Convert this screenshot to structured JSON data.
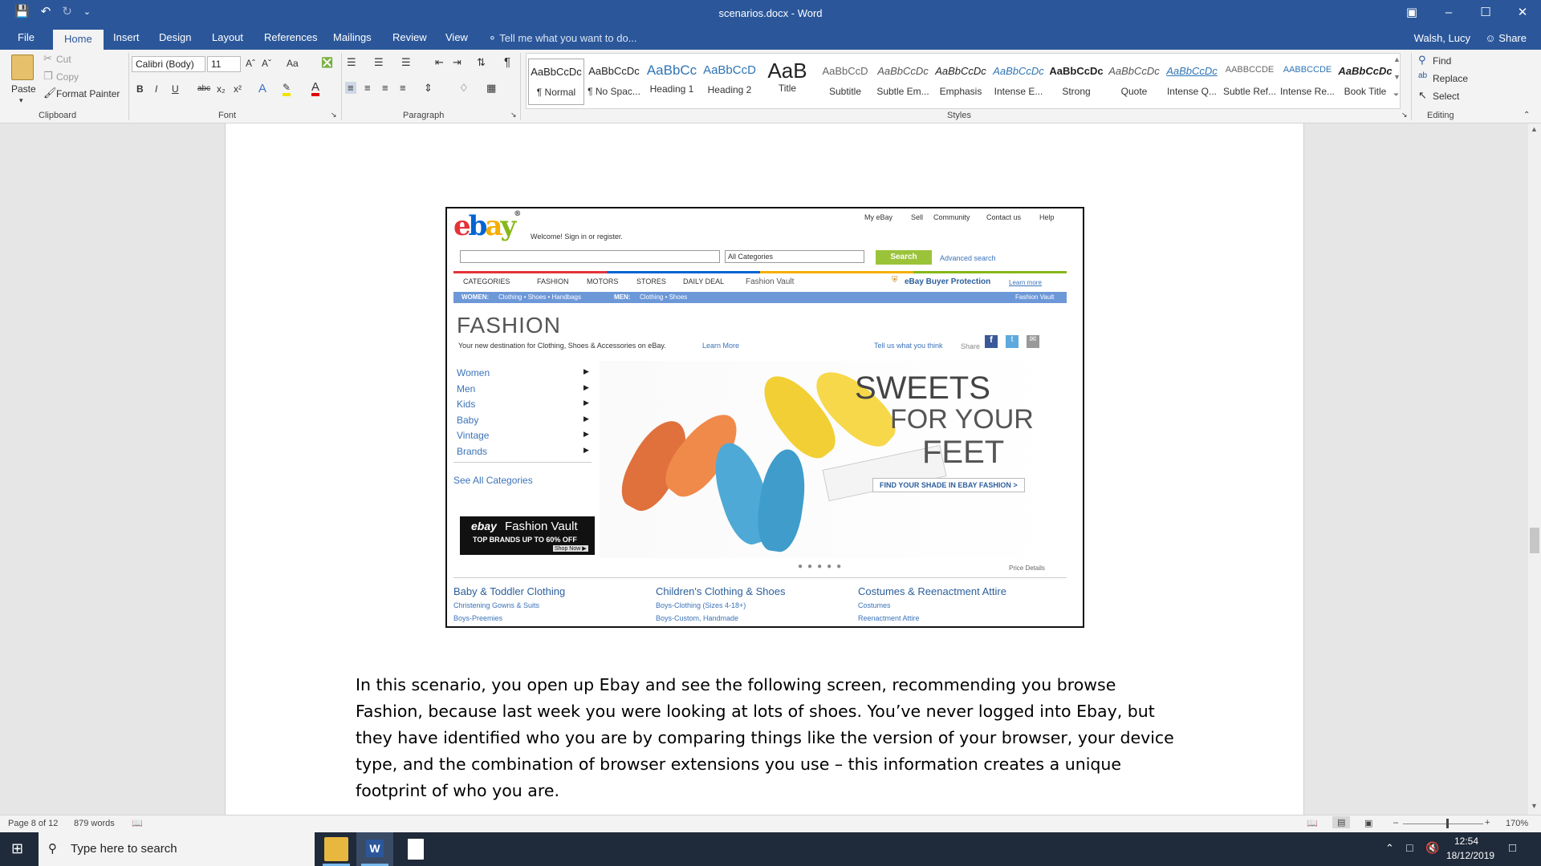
{
  "window": {
    "title": "scenarios.docx - Word",
    "qat_more": "⌄"
  },
  "tabs": [
    "File",
    "Home",
    "Insert",
    "Design",
    "Layout",
    "References",
    "Mailings",
    "Review",
    "View"
  ],
  "tell_me": "Tell me what you want to do...",
  "user": "Walsh, Lucy",
  "share": "Share",
  "clipboard": {
    "paste": "Paste",
    "cut": "Cut",
    "copy": "Copy",
    "format_painter": "Format Painter",
    "label": "Clipboard"
  },
  "font": {
    "name": "Calibri (Body)",
    "size": "11",
    "case": "Aa",
    "bold": "B",
    "italic": "I",
    "underline": "U",
    "strike": "abc",
    "sub": "x₂",
    "sup": "x²",
    "label": "Font"
  },
  "paragraph": {
    "label": "Paragraph"
  },
  "styles": {
    "label": "Styles",
    "items": [
      {
        "sample": "AaBbCcDc",
        "name": "¶ Normal"
      },
      {
        "sample": "AaBbCcDc",
        "name": "¶ No Spac..."
      },
      {
        "sample": "AaBbCc",
        "name": "Heading 1"
      },
      {
        "sample": "AaBbCcD",
        "name": "Heading 2"
      },
      {
        "sample": "AaB",
        "name": "Title"
      },
      {
        "sample": "AaBbCcD",
        "name": "Subtitle"
      },
      {
        "sample": "AaBbCcDc",
        "name": "Subtle Em..."
      },
      {
        "sample": "AaBbCcDc",
        "name": "Emphasis"
      },
      {
        "sample": "AaBbCcDc",
        "name": "Intense E..."
      },
      {
        "sample": "AaBbCcDc",
        "name": "Strong"
      },
      {
        "sample": "AaBbCcDc",
        "name": "Quote"
      },
      {
        "sample": "AaBbCcDc",
        "name": "Intense Q..."
      },
      {
        "sample": "AABBCCDE",
        "name": "Subtle Ref..."
      },
      {
        "sample": "AABBCCDE",
        "name": "Intense Re..."
      },
      {
        "sample": "AaBbCcDc",
        "name": "Book Title"
      }
    ]
  },
  "editing": {
    "find": "Find",
    "replace": "Replace",
    "select": "Select",
    "label": "Editing"
  },
  "ebay": {
    "logo": [
      "e",
      "b",
      "a",
      "y"
    ],
    "trademark": "®",
    "top_links": [
      "My eBay",
      "Sell",
      "Community",
      "Contact us",
      "Help"
    ],
    "welcome": "Welcome! Sign in or register.",
    "category_select": "All Categories",
    "search_button": "Search",
    "advanced": "Advanced search",
    "nav": [
      "CATEGORIES",
      "FASHION",
      "MOTORS",
      "STORES",
      "DAILY DEAL",
      "Fashion Vault"
    ],
    "protection": "eBay Buyer Protection",
    "learn_more": "Learn more",
    "subnav_women": "WOMEN:",
    "subnav_women_links": "Clothing • Shoes • Handbags",
    "subnav_men": "MEN:",
    "subnav_men_links": "Clothing • Shoes",
    "subnav_right": "Fashion Vault",
    "heading": "FASHION",
    "tagline": "Your new destination for Clothing, Shoes & Accessories on eBay.",
    "tagline_link": "Learn More",
    "tell_us": "Tell us what you think",
    "share": "Share",
    "categories": [
      "Women",
      "Men",
      "Kids",
      "Baby",
      "Vintage",
      "Brands"
    ],
    "see_all": "See All Categories",
    "vault_logo": "ebay",
    "vault_title": "Fashion Vault",
    "vault_sub": "TOP BRANDS UP TO 60% OFF",
    "vault_cta": "Shop Now ▶",
    "hero_line1": "SWEETS",
    "hero_line2": "FOR YOUR",
    "hero_line3": "FEET",
    "hero_cta": "FIND YOUR SHADE IN EBAY FASHION >",
    "price_details": "Price Details",
    "bottom": [
      {
        "title": "Baby & Toddler Clothing",
        "links": [
          "Christening Gowns & Suits",
          "Boys-Preemies"
        ]
      },
      {
        "title": "Children's Clothing & Shoes",
        "links": [
          "Boys-Clothing (Sizes 4-18+)",
          "Boys-Custom, Handmade"
        ]
      },
      {
        "title": "Costumes & Reenactment Attire",
        "links": [
          "Costumes",
          "Reenactment Attire"
        ]
      }
    ]
  },
  "body_text": "In this scenario, you open up Ebay and see the following screen, recommending you browse Fashion, because last week you were looking at lots of shoes. You’ve never logged into Ebay, but they have identified who you are by comparing things like the version of your browser, your device type, and the combination of browser extensions you use – this information creates a unique footprint of who you are.",
  "status": {
    "page": "Page 8 of 12",
    "words": "879 words",
    "zoom": "170%"
  },
  "taskbar": {
    "search": "Type here to search",
    "time": "12:54",
    "date": "18/12/2019"
  }
}
